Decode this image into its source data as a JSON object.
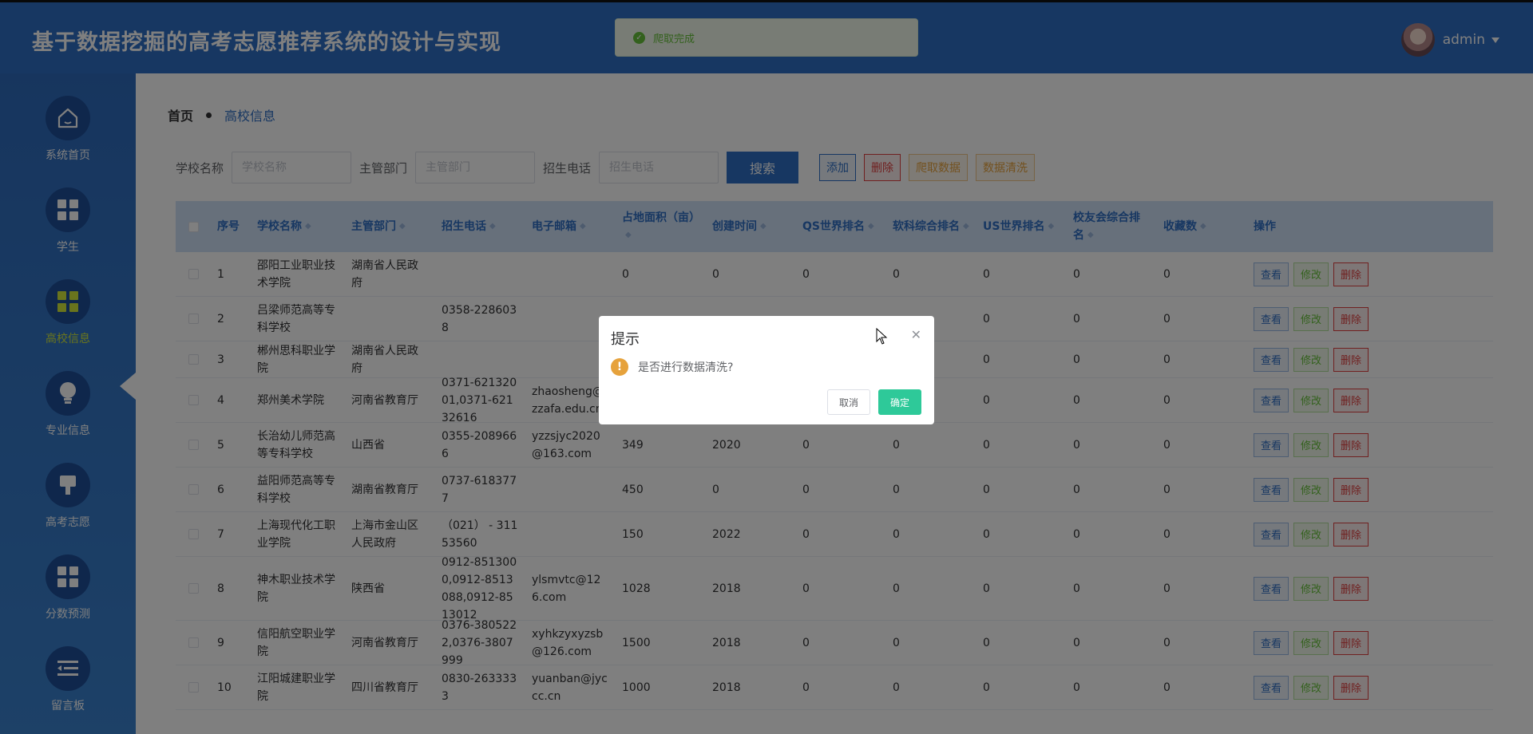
{
  "header": {
    "title": "基于数据挖掘的高考志愿推荐系统的设计与实现",
    "username": "admin"
  },
  "toast": {
    "message": "爬取完成"
  },
  "sidebar": {
    "items": [
      {
        "label": "系统首页",
        "icon": "home-icon"
      },
      {
        "label": "学生",
        "icon": "grid-icon"
      },
      {
        "label": "高校信息",
        "icon": "grid-icon",
        "active": true
      },
      {
        "label": "专业信息",
        "icon": "lightbulb-icon"
      },
      {
        "label": "高考志愿",
        "icon": "brush-icon"
      },
      {
        "label": "分数预测",
        "icon": "grid-icon"
      },
      {
        "label": "留言板",
        "icon": "list-icon"
      }
    ]
  },
  "breadcrumb": {
    "home": "首页",
    "current": "高校信息"
  },
  "search": {
    "school_label": "学校名称",
    "school_placeholder": "学校名称",
    "dept_label": "主管部门",
    "dept_placeholder": "主管部门",
    "tel_label": "招生电话",
    "tel_placeholder": "招生电话",
    "search_btn": "搜索",
    "add_btn": "添加",
    "delete_btn": "删除",
    "crawl_btn": "爬取数据",
    "clean_btn": "数据清洗"
  },
  "table": {
    "headers": [
      "序号",
      "学校名称",
      "主管部门",
      "招生电话",
      "电子邮箱",
      "占地面积（亩）",
      "创建时间",
      "QS世界排名",
      "软科综合排名",
      "US世界排名",
      "校友会综合排名",
      "收藏数",
      "操作"
    ],
    "actions": {
      "view": "查看",
      "edit": "修改",
      "delete": "删除"
    },
    "rows": [
      [
        "1",
        "邵阳工业职业技术学院",
        "湖南省人民政府",
        "",
        "",
        "0",
        "0",
        "0",
        "0",
        "0",
        "0",
        "0"
      ],
      [
        "2",
        "吕梁师范高等专科学校",
        "",
        "0358-2286038",
        "",
        "",
        "",
        "",
        "",
        "0",
        "0",
        "0"
      ],
      [
        "3",
        "郴州思科职业学院",
        "湖南省人民政府",
        "",
        "",
        "",
        "",
        "",
        "",
        "0",
        "0",
        "0"
      ],
      [
        "4",
        "郑州美术学院",
        "河南省教育厅",
        "0371-62132001,0371-62132616",
        "zhaosheng@zzafa.edu.cn",
        "",
        "",
        "",
        "",
        "0",
        "0",
        "0"
      ],
      [
        "5",
        "长治幼儿师范高等专科学校",
        "山西省",
        "0355-2089666",
        "yzzsjyc2020@163.com",
        "349",
        "2020",
        "0",
        "0",
        "0",
        "0",
        "0"
      ],
      [
        "6",
        "益阳师范高等专科学校",
        "湖南省教育厅",
        "0737-6183777",
        "",
        "450",
        "0",
        "0",
        "0",
        "0",
        "0",
        "0"
      ],
      [
        "7",
        "上海现代化工职业学院",
        "上海市金山区人民政府",
        "（021） - 31153560",
        "",
        "150",
        "2022",
        "0",
        "0",
        "0",
        "0",
        "0"
      ],
      [
        "8",
        "神木职业技术学院",
        "陕西省",
        "0912-8513000,0912-8513088,0912-8513012",
        "ylsmvtc@126.com",
        "1028",
        "2018",
        "0",
        "0",
        "0",
        "0",
        "0"
      ],
      [
        "9",
        "信阳航空职业学院",
        "河南省教育厅",
        "0376-3805222,0376-3807999",
        "xyhkzyxyzsb@126.com",
        "1500",
        "2018",
        "0",
        "0",
        "0",
        "0",
        "0"
      ],
      [
        "10",
        "江阳城建职业学院",
        "四川省教育厅",
        "0830-2633333",
        "yuanban@jyccc.cn",
        "1000",
        "2018",
        "0",
        "0",
        "0",
        "0",
        "0"
      ]
    ]
  },
  "dialog": {
    "title": "提示",
    "message": "是否进行数据清洗?",
    "cancel": "取消",
    "confirm": "确定"
  }
}
